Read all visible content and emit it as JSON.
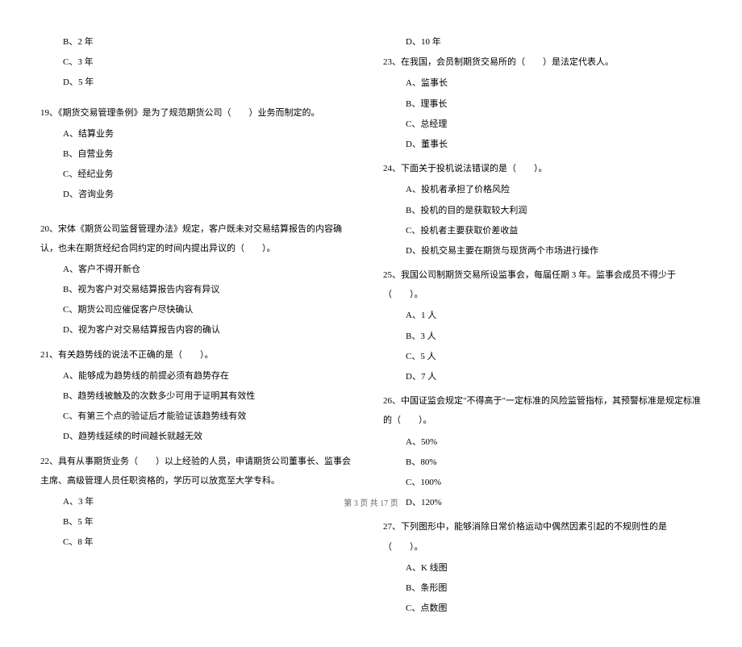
{
  "left_column": {
    "q18_options": [
      "B、2 年",
      "C、3 年",
      "D、5 年"
    ],
    "q19": {
      "text": "19、《期货交易管理条例》是为了规范期货公司（　　）业务而制定的。",
      "options": [
        "A、结算业务",
        "B、自营业务",
        "C、经纪业务",
        "D、咨询业务"
      ]
    },
    "q20": {
      "text": "20、宋体《期货公司监督管理办法》规定，客户既未对交易结算报告的内容确认，也未在期货经纪合同约定的时间内提出异议的（　　）。",
      "options": [
        "A、客户不得开新仓",
        "B、视为客户对交易结算报告内容有异议",
        "C、期货公司应催促客户尽快确认",
        "D、视为客户对交易结算报告内容的确认"
      ]
    },
    "q21": {
      "text": "21、有关趋势线的说法不正确的是（　　）。",
      "options": [
        "A、能够成为趋势线的前提必须有趋势存在",
        "B、趋势线被触及的次数多少可用于证明其有效性",
        "C、有第三个点的验证后才能验证该趋势线有效",
        "D、趋势线延续的时间越长就越无效"
      ]
    },
    "q22": {
      "text": "22、具有从事期货业务（　　）以上经验的人员，申请期货公司董事长、监事会主席、高级管理人员任职资格的，学历可以放宽至大学专科。",
      "options": [
        "A、3 年",
        "B、5 年",
        "C、8 年"
      ]
    }
  },
  "right_column": {
    "q22_option_d": "D、10 年",
    "q23": {
      "text": "23、在我国，会员制期货交易所的（　　）是法定代表人。",
      "options": [
        "A、监事长",
        "B、理事长",
        "C、总经理",
        "D、董事长"
      ]
    },
    "q24": {
      "text": "24、下面关于投机说法错误的是（　　）。",
      "options": [
        "A、投机者承担了价格风险",
        "B、投机的目的是获取较大利润",
        "C、投机者主要获取价差收益",
        "D、投机交易主要在期货与现货两个市场进行操作"
      ]
    },
    "q25": {
      "text": "25、我国公司制期货交易所设监事会，每届任期 3 年。监事会成员不得少于（　　）。",
      "options": [
        "A、1 人",
        "B、3 人",
        "C、5 人",
        "D、7 人"
      ]
    },
    "q26": {
      "text": "26、中国证监会规定\"不得高于\"一定标准的风险监管指标，其预警标准是规定标准的（　　）。",
      "options": [
        "A、50%",
        "B、80%",
        "C、100%",
        "D、120%"
      ]
    },
    "q27": {
      "text": "27、下列图形中，能够消除日常价格运动中偶然因素引起的不规则性的是（　　）。",
      "options": [
        "A、K 线图",
        "B、条形图",
        "C、点数图"
      ]
    }
  },
  "footer": "第 3 页 共 17 页"
}
